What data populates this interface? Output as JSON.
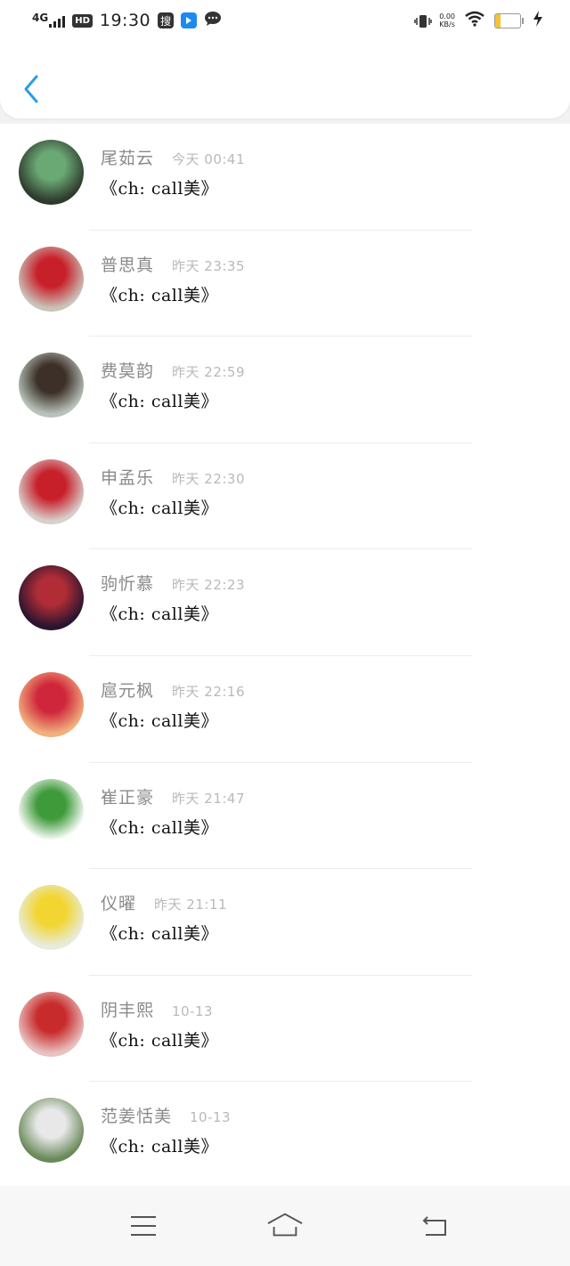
{
  "status_bar": {
    "network": "4G",
    "hd": "HD",
    "time": "19:30",
    "app_icon_search": "搜",
    "net_speed_value": "0.00",
    "net_speed_unit": "KB/s",
    "battery": "23",
    "colors": {
      "battery_fill": "#f3c236",
      "app_blue": "#1c8af0"
    }
  },
  "header": {
    "back_icon": "chevron-left-icon",
    "accent": "#2a9fe0"
  },
  "contacts": [
    {
      "name": "尾茹云",
      "time": "今天 00:41",
      "message": "《ch: call美》",
      "avatar_colors": [
        "#2e3a2d",
        "#6aa874"
      ]
    },
    {
      "name": "普思真",
      "time": "昨天 23:35",
      "message": "《ch: call美》",
      "avatar_colors": [
        "#c9c3b8",
        "#c8202a"
      ]
    },
    {
      "name": "费莫韵",
      "time": "昨天 22:59",
      "message": "《ch: call美》",
      "avatar_colors": [
        "#b8c2ba",
        "#3c3028"
      ]
    },
    {
      "name": "申孟乐",
      "time": "昨天 22:30",
      "message": "《ch: call美》",
      "avatar_colors": [
        "#d8d0cc",
        "#c8202a"
      ]
    },
    {
      "name": "驹忻慕",
      "time": "昨天 22:23",
      "message": "《ch: call美》",
      "avatar_colors": [
        "#2a1530",
        "#b02c36"
      ]
    },
    {
      "name": "扈元枫",
      "time": "昨天 22:16",
      "message": "《ch: call美》",
      "avatar_colors": [
        "#f1b07d",
        "#d0263c"
      ]
    },
    {
      "name": "崔正豪",
      "time": "昨天 21:47",
      "message": "《ch: call美》",
      "avatar_colors": [
        "#ffffff",
        "#3f9a3a"
      ]
    },
    {
      "name": "仪曜",
      "time": "昨天 21:11",
      "message": "《ch: call美》",
      "avatar_colors": [
        "#e7ecdd",
        "#f2d531"
      ]
    },
    {
      "name": "阴丰熙",
      "time": "10-13",
      "message": "《ch: call美》",
      "avatar_colors": [
        "#e8c2c0",
        "#c82b2b"
      ]
    },
    {
      "name": "范姜恬美",
      "time": "10-13",
      "message": "《ch: call美》",
      "avatar_colors": [
        "#6a8a5a",
        "#e8e8e8"
      ]
    }
  ],
  "bottom_nav": {
    "menu_icon": "menu-icon",
    "home_icon": "home-icon",
    "back_icon": "return-icon"
  }
}
